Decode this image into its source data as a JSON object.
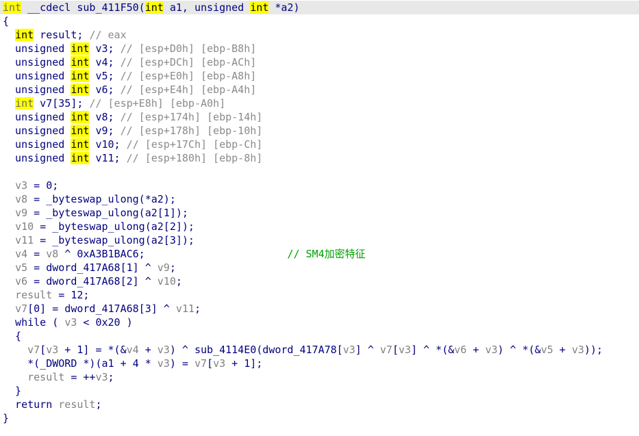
{
  "colors": {
    "background": "#ffffff",
    "current_line": "#e8e8e8",
    "keyword_highlight": "#ffff00",
    "code_text": "#000080",
    "local_var": "#808080",
    "comment": "#8a8a8a",
    "sm4_comment": "#00a000"
  },
  "lines": [
    [
      {
        "t": "int",
        "s": "kw dim"
      },
      {
        "t": " __cdecl sub_411F50(",
        "s": "plain"
      },
      {
        "t": "int",
        "s": "kw"
      },
      {
        "t": " a1, unsigned ",
        "s": "plain"
      },
      {
        "t": "int",
        "s": "kw"
      },
      {
        "t": " *a2)",
        "s": "plain"
      }
    ],
    [
      {
        "t": "{",
        "s": "plain"
      }
    ],
    [
      {
        "t": "  ",
        "s": "plain"
      },
      {
        "t": "int",
        "s": "kw"
      },
      {
        "t": " result; ",
        "s": "plain"
      },
      {
        "t": "// eax",
        "s": "cmt"
      }
    ],
    [
      {
        "t": "  unsigned ",
        "s": "plain"
      },
      {
        "t": "int",
        "s": "kw"
      },
      {
        "t": " v3; ",
        "s": "plain"
      },
      {
        "t": "// [esp+D0h] [ebp-B8h]",
        "s": "cmt"
      }
    ],
    [
      {
        "t": "  unsigned ",
        "s": "plain"
      },
      {
        "t": "int",
        "s": "kw"
      },
      {
        "t": " v4; ",
        "s": "plain"
      },
      {
        "t": "// [esp+DCh] [ebp-ACh]",
        "s": "cmt"
      }
    ],
    [
      {
        "t": "  unsigned ",
        "s": "plain"
      },
      {
        "t": "int",
        "s": "kw"
      },
      {
        "t": " v5; ",
        "s": "plain"
      },
      {
        "t": "// [esp+E0h] [ebp-A8h]",
        "s": "cmt"
      }
    ],
    [
      {
        "t": "  unsigned ",
        "s": "plain"
      },
      {
        "t": "int",
        "s": "kw"
      },
      {
        "t": " v6; ",
        "s": "plain"
      },
      {
        "t": "// [esp+E4h] [ebp-A4h]",
        "s": "cmt"
      }
    ],
    [
      {
        "t": "  ",
        "s": "plain"
      },
      {
        "t": "int",
        "s": "kw dim"
      },
      {
        "t": " v7[35]; ",
        "s": "plain"
      },
      {
        "t": "// [esp+E8h] [ebp-A0h]",
        "s": "cmt"
      }
    ],
    [
      {
        "t": "  unsigned ",
        "s": "plain"
      },
      {
        "t": "int",
        "s": "kw"
      },
      {
        "t": " v8; ",
        "s": "plain"
      },
      {
        "t": "// [esp+174h] [ebp-14h]",
        "s": "cmt"
      }
    ],
    [
      {
        "t": "  unsigned ",
        "s": "plain"
      },
      {
        "t": "int",
        "s": "kw"
      },
      {
        "t": " v9; ",
        "s": "plain"
      },
      {
        "t": "// [esp+178h] [ebp-10h]",
        "s": "cmt"
      }
    ],
    [
      {
        "t": "  unsigned ",
        "s": "plain"
      },
      {
        "t": "int",
        "s": "kw"
      },
      {
        "t": " v10; ",
        "s": "plain"
      },
      {
        "t": "// [esp+17Ch] [ebp-Ch]",
        "s": "cmt"
      }
    ],
    [
      {
        "t": "  unsigned ",
        "s": "plain"
      },
      {
        "t": "int",
        "s": "kw"
      },
      {
        "t": " v11; ",
        "s": "plain"
      },
      {
        "t": "// [esp+180h] [ebp-8h]",
        "s": "cmt"
      }
    ],
    [
      {
        "t": "",
        "s": "plain"
      }
    ],
    [
      {
        "t": "  ",
        "s": "plain"
      },
      {
        "t": "v3",
        "s": "var"
      },
      {
        "t": " = 0;",
        "s": "plain"
      }
    ],
    [
      {
        "t": "  ",
        "s": "plain"
      },
      {
        "t": "v8",
        "s": "var"
      },
      {
        "t": " = _byteswap_ulong(*a2);",
        "s": "plain"
      }
    ],
    [
      {
        "t": "  ",
        "s": "plain"
      },
      {
        "t": "v9",
        "s": "var"
      },
      {
        "t": " = _byteswap_ulong(a2[1]);",
        "s": "plain"
      }
    ],
    [
      {
        "t": "  ",
        "s": "plain"
      },
      {
        "t": "v10",
        "s": "var"
      },
      {
        "t": " = _byteswap_ulong(a2[2]);",
        "s": "plain"
      }
    ],
    [
      {
        "t": "  ",
        "s": "plain"
      },
      {
        "t": "v11",
        "s": "var"
      },
      {
        "t": " = _byteswap_ulong(a2[3]);",
        "s": "plain"
      }
    ],
    [
      {
        "t": "  ",
        "s": "plain"
      },
      {
        "t": "v4",
        "s": "var"
      },
      {
        "t": " = ",
        "s": "plain"
      },
      {
        "t": "v8",
        "s": "var"
      },
      {
        "t": " ^ 0xA3B1BAC6;                       ",
        "s": "plain"
      },
      {
        "t": "// SM4加密特征",
        "s": "cmt green"
      }
    ],
    [
      {
        "t": "  ",
        "s": "plain"
      },
      {
        "t": "v5",
        "s": "var"
      },
      {
        "t": " = dword_417A68[1] ^ ",
        "s": "plain"
      },
      {
        "t": "v9",
        "s": "var"
      },
      {
        "t": ";",
        "s": "plain"
      }
    ],
    [
      {
        "t": "  ",
        "s": "plain"
      },
      {
        "t": "v6",
        "s": "var"
      },
      {
        "t": " = dword_417A68[2] ^ ",
        "s": "plain"
      },
      {
        "t": "v10",
        "s": "var"
      },
      {
        "t": ";",
        "s": "plain"
      }
    ],
    [
      {
        "t": "  ",
        "s": "plain"
      },
      {
        "t": "result",
        "s": "var"
      },
      {
        "t": " = 12;",
        "s": "plain"
      }
    ],
    [
      {
        "t": "  ",
        "s": "plain"
      },
      {
        "t": "v7",
        "s": "var"
      },
      {
        "t": "[0] = dword_417A68[3] ^ ",
        "s": "plain"
      },
      {
        "t": "v11",
        "s": "var"
      },
      {
        "t": ";",
        "s": "plain"
      }
    ],
    [
      {
        "t": "  while ( ",
        "s": "plain"
      },
      {
        "t": "v3",
        "s": "var"
      },
      {
        "t": " < 0x20 )",
        "s": "plain"
      }
    ],
    [
      {
        "t": "  {",
        "s": "plain"
      }
    ],
    [
      {
        "t": "    ",
        "s": "plain"
      },
      {
        "t": "v7",
        "s": "var"
      },
      {
        "t": "[",
        "s": "plain"
      },
      {
        "t": "v3",
        "s": "var"
      },
      {
        "t": " + 1] = *(&",
        "s": "plain"
      },
      {
        "t": "v4",
        "s": "var"
      },
      {
        "t": " + ",
        "s": "plain"
      },
      {
        "t": "v3",
        "s": "var"
      },
      {
        "t": ") ^ sub_4114E0(dword_417A78[",
        "s": "plain"
      },
      {
        "t": "v3",
        "s": "var"
      },
      {
        "t": "] ^ ",
        "s": "plain"
      },
      {
        "t": "v7",
        "s": "var"
      },
      {
        "t": "[",
        "s": "plain"
      },
      {
        "t": "v3",
        "s": "var"
      },
      {
        "t": "] ^ *(&",
        "s": "plain"
      },
      {
        "t": "v6",
        "s": "var"
      },
      {
        "t": " + ",
        "s": "plain"
      },
      {
        "t": "v3",
        "s": "var"
      },
      {
        "t": ") ^ *(&",
        "s": "plain"
      },
      {
        "t": "v5",
        "s": "var"
      },
      {
        "t": " + ",
        "s": "plain"
      },
      {
        "t": "v3",
        "s": "var"
      },
      {
        "t": "));",
        "s": "plain"
      }
    ],
    [
      {
        "t": "    *(_DWORD *)(a1 + 4 * ",
        "s": "plain"
      },
      {
        "t": "v3",
        "s": "var"
      },
      {
        "t": ") = ",
        "s": "plain"
      },
      {
        "t": "v7",
        "s": "var"
      },
      {
        "t": "[",
        "s": "plain"
      },
      {
        "t": "v3",
        "s": "var"
      },
      {
        "t": " + 1];",
        "s": "plain"
      }
    ],
    [
      {
        "t": "    ",
        "s": "plain"
      },
      {
        "t": "result",
        "s": "var"
      },
      {
        "t": " = ++",
        "s": "plain"
      },
      {
        "t": "v3",
        "s": "var"
      },
      {
        "t": ";",
        "s": "plain"
      }
    ],
    [
      {
        "t": "  }",
        "s": "plain"
      }
    ],
    [
      {
        "t": "  return ",
        "s": "plain"
      },
      {
        "t": "result",
        "s": "var"
      },
      {
        "t": ";",
        "s": "plain"
      }
    ],
    [
      {
        "t": "}",
        "s": "plain"
      }
    ]
  ]
}
